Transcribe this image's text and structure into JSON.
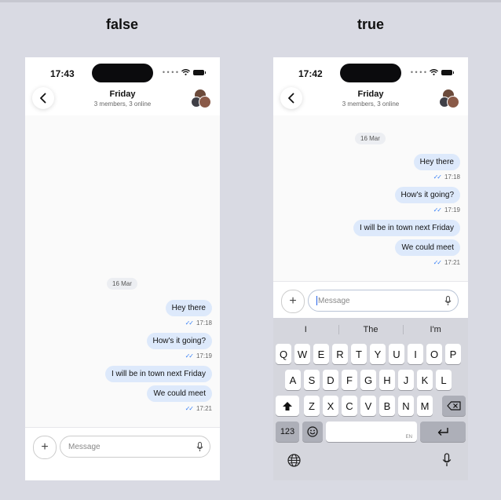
{
  "columns": [
    {
      "title": "false"
    },
    {
      "title": "true"
    }
  ],
  "phones": [
    {
      "status_time": "17:43",
      "header": {
        "title": "Friday",
        "subtitle": "3 members, 3 online"
      },
      "date_chip": "16 Mar",
      "messages": [
        {
          "text": "Hey there",
          "time": "17:18"
        },
        {
          "text": "How's it going?",
          "time": "17:19"
        },
        {
          "text": "I will be in town next Friday",
          "time": ""
        },
        {
          "text": "We could meet",
          "time": "17:21"
        }
      ],
      "composer": {
        "placeholder": "Message"
      }
    },
    {
      "status_time": "17:42",
      "header": {
        "title": "Friday",
        "subtitle": "3 members, 3 online"
      },
      "date_chip": "16 Mar",
      "messages": [
        {
          "text": "Hey there",
          "time": "17:18"
        },
        {
          "text": "How's it going?",
          "time": "17:19"
        },
        {
          "text": "I will be in town next Friday",
          "time": ""
        },
        {
          "text": "We could meet",
          "time": "17:21"
        }
      ],
      "composer": {
        "placeholder": "Message"
      },
      "keyboard": {
        "suggestions": [
          "I",
          "The",
          "I'm"
        ],
        "row1": [
          "Q",
          "W",
          "E",
          "R",
          "T",
          "Y",
          "U",
          "I",
          "O",
          "P"
        ],
        "row2": [
          "A",
          "S",
          "D",
          "F",
          "G",
          "H",
          "J",
          "K",
          "L"
        ],
        "row3": [
          "Z",
          "X",
          "C",
          "V",
          "B",
          "N",
          "M"
        ],
        "numbers_key": "123",
        "space_lang": "EN"
      }
    }
  ],
  "icons": {
    "back": "chevron-left-icon",
    "add": "plus-icon",
    "mic": "microphone-icon",
    "shift": "shift-icon",
    "delete": "backspace-icon",
    "emoji": "emoji-icon",
    "return": "return-icon",
    "globe": "globe-icon",
    "dictation": "microphone-icon"
  },
  "colors": {
    "bubble": "#dde9fb",
    "ticks": "#3b82f6",
    "background": "#d9dae3",
    "keyboard": "#d5d6dd"
  }
}
